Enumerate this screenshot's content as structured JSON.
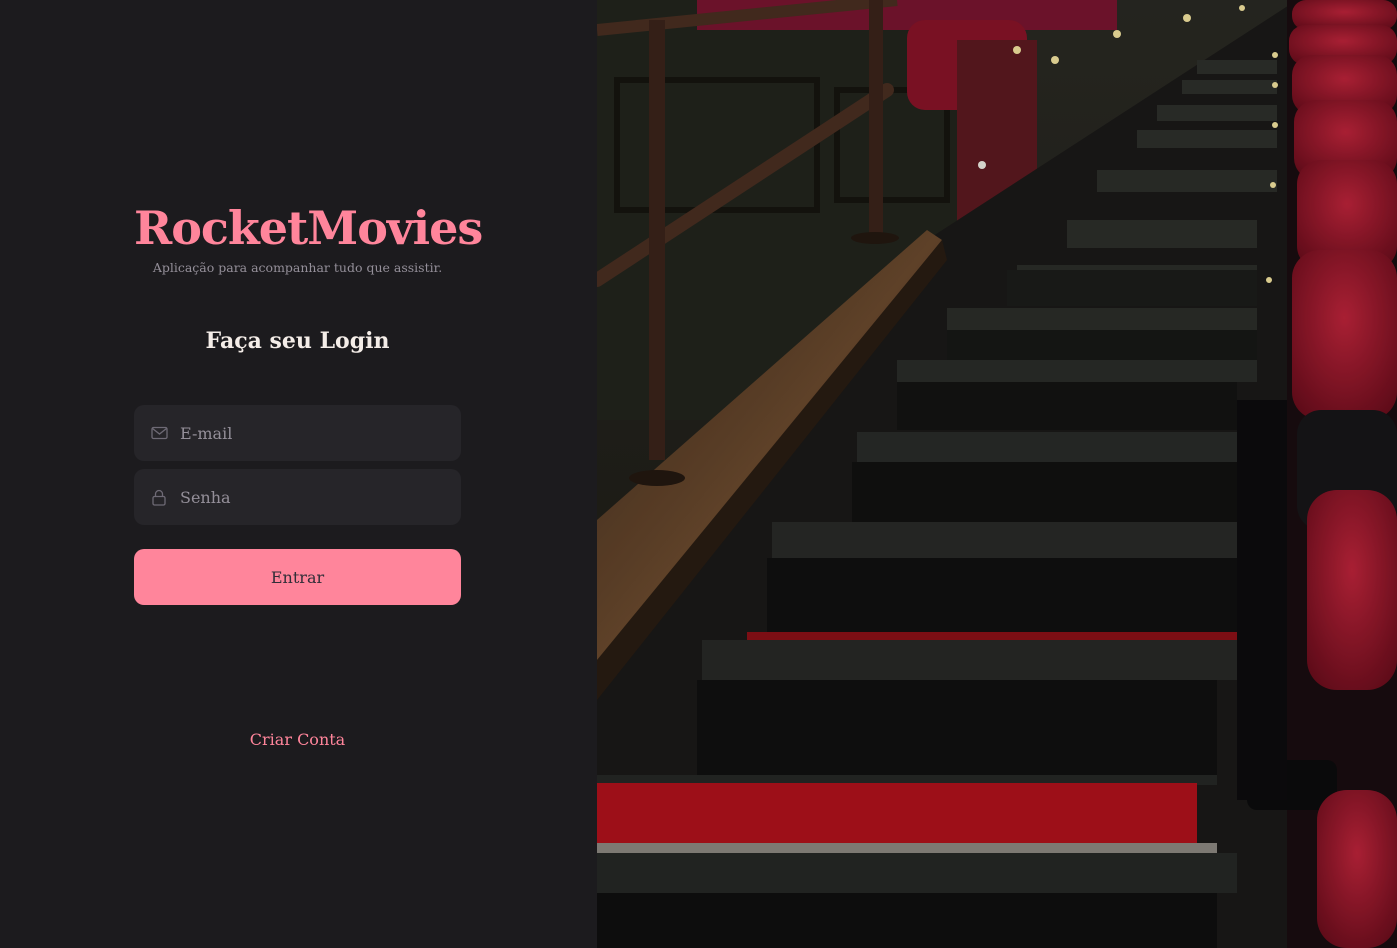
{
  "brand": {
    "title": "RocketMovies",
    "tagline": "Aplicação para acompanhar tudo que assistir."
  },
  "login": {
    "heading": "Faça seu Login",
    "email_placeholder": "E-mail",
    "password_placeholder": "Senha",
    "submit_label": "Entrar",
    "create_account_label": "Criar Conta"
  },
  "icons": {
    "email": "mail-icon",
    "password": "lock-icon"
  },
  "colors": {
    "background": "#1c1b1e",
    "accent": "#ff859b",
    "input_bg": "#262529",
    "text_muted": "#948f99"
  }
}
